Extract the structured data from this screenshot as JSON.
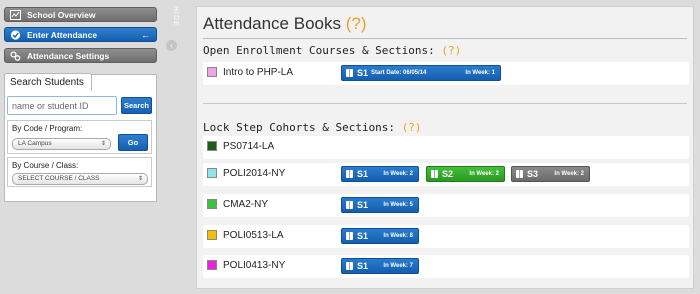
{
  "sidebar": {
    "nav": [
      {
        "label": "School Overview",
        "icon": "overview-icon"
      },
      {
        "label": "Enter Attendance",
        "icon": "check-icon",
        "active": true,
        "arrow": "←"
      },
      {
        "label": "Attendance Settings",
        "icon": "settings-icon"
      }
    ],
    "search": {
      "tab_label": "Search Students",
      "input_placeholder": "name or student ID",
      "search_button": "Search",
      "by_code_label": "By Code / Program:",
      "code_select_value": "LA Campus",
      "go_button": "Go",
      "by_course_label": "By Course / Class:",
      "course_select_value": "SELECT COURSE / CLASS"
    }
  },
  "collapse": {
    "label": "HIDE"
  },
  "main": {
    "title": "Attendance Books",
    "help": "(?)",
    "open_section": {
      "title": "Open Enrollment Courses & Sections:",
      "help": "(?)"
    },
    "open_rows": [
      {
        "label": "Intro to PHP-LA",
        "color": "#f0a6e6",
        "sections": [
          {
            "name": "S1",
            "start_date": "Start Date: 06/05/14",
            "week": "In Week: 1",
            "style": "blue"
          }
        ]
      }
    ],
    "lock_section": {
      "title": "Lock Step Cohorts & Sections:",
      "help": "(?)"
    },
    "lock_rows": [
      {
        "label": "PS0714-LA",
        "color": "#1f5a1f",
        "sections": []
      },
      {
        "label": "POLI2014-NY",
        "color": "#8ee6ee",
        "sections": [
          {
            "name": "S1",
            "week": "In Week: 2",
            "style": "blue"
          },
          {
            "name": "S2",
            "week": "In Week: 2",
            "style": "green"
          },
          {
            "name": "S3",
            "week": "In Week: 2",
            "style": "grey"
          }
        ]
      },
      {
        "label": "CMA2-NY",
        "color": "#3cc23c",
        "sections": [
          {
            "name": "S1",
            "week": "In Week: 5",
            "style": "blue"
          }
        ]
      },
      {
        "label": "POLI0513-LA",
        "color": "#f0c000",
        "sections": [
          {
            "name": "S1",
            "week": "In Week: 8",
            "style": "blue"
          }
        ]
      },
      {
        "label": "POLI0413-NY",
        "color": "#ee22dd",
        "sections": [
          {
            "name": "S1",
            "week": "In Week: 7",
            "style": "blue"
          }
        ]
      }
    ]
  }
}
